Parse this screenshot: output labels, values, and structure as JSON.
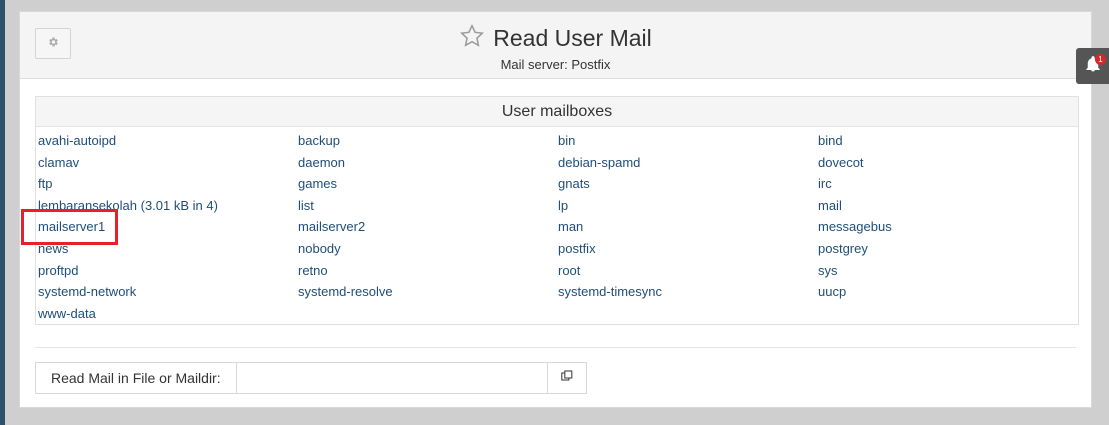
{
  "header": {
    "title": "Read User Mail",
    "subtitle": "Mail server: Postfix",
    "icons": {
      "settings": "gear-icon",
      "favorite": "star-outline-icon"
    }
  },
  "mailboxes": {
    "heading": "User mailboxes",
    "items": [
      "avahi-autoipd",
      "backup",
      "bin",
      "bind",
      "clamav",
      "daemon",
      "debian-spamd",
      "dovecot",
      "ftp",
      "games",
      "gnats",
      "irc",
      "lembaransekolah (3.01 kB in 4)",
      "list",
      "lp",
      "mail",
      "mailserver1",
      "mailserver2",
      "man",
      "messagebus",
      "news",
      "nobody",
      "postfix",
      "postgrey",
      "proftpd",
      "retno",
      "root",
      "sys",
      "systemd-network",
      "systemd-resolve",
      "systemd-timesync",
      "uucp",
      "www-data"
    ],
    "highlighted_item": "mailserver1",
    "link_color": "#1f4e79",
    "highlight_color": "#e3232b"
  },
  "read_mail": {
    "label": "Read Mail in File or Maildir:",
    "value": "",
    "button_icon": "file-browse-icon"
  },
  "notifications": {
    "count": "1",
    "icon": "bell-icon"
  }
}
